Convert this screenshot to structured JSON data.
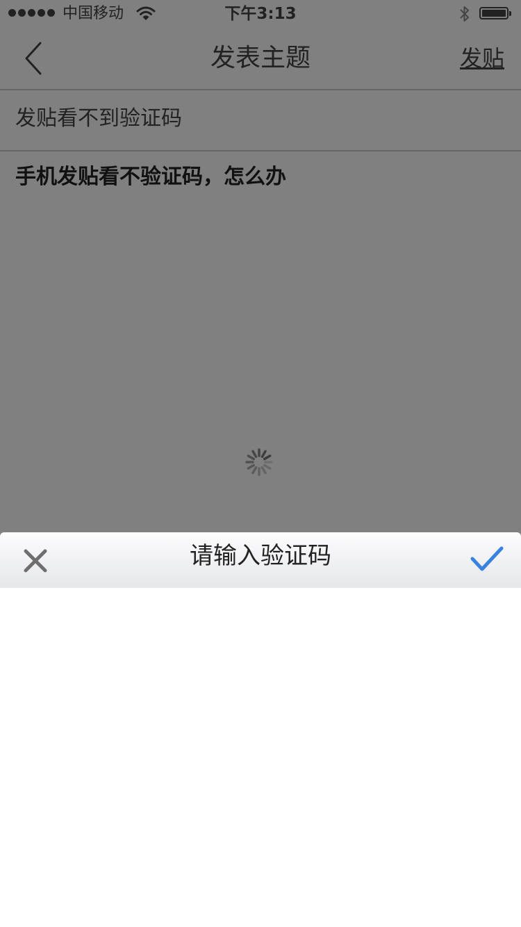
{
  "status_bar": {
    "carrier": "中国移动",
    "time": "下午3:13",
    "icons": [
      "signal-dots-icon",
      "wifi-icon",
      "bluetooth-icon",
      "battery-icon"
    ]
  },
  "nav": {
    "back_icon": "chevron-left-icon",
    "title": "发表主题",
    "post_label": "发贴"
  },
  "post": {
    "subject": "发贴看不到验证码",
    "content": "手机发贴看不验证码，怎么办"
  },
  "loading_icon": "spinner-icon",
  "captcha_sheet": {
    "title": "请输入验证码",
    "close_icon": "close-icon",
    "confirm_icon": "checkmark-icon",
    "accent_color": "#3a82e0"
  },
  "colors": {
    "overlay": "#808080",
    "text": "#222222"
  }
}
